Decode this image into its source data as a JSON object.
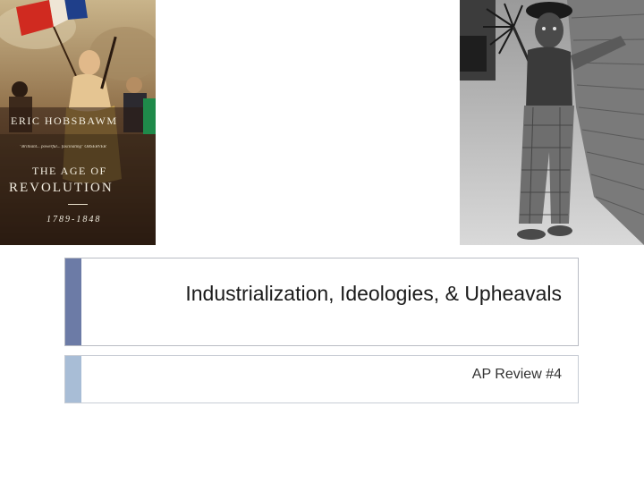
{
  "cover": {
    "author": "ERIC HOBSBAWM",
    "blurb": "\"Brilliant... powerful... fascinating\" OBSERVER",
    "title_line1": "THE AGE OF",
    "title_line2": "REVOLUTION",
    "dates": "1789-1848"
  },
  "slide": {
    "title": "Industrialization, Ideologies, & Upheavals",
    "subtitle": "AP Review #4"
  },
  "colors": {
    "title_accent": "#6c7ba6",
    "subtitle_accent": "#a8bdd6"
  }
}
